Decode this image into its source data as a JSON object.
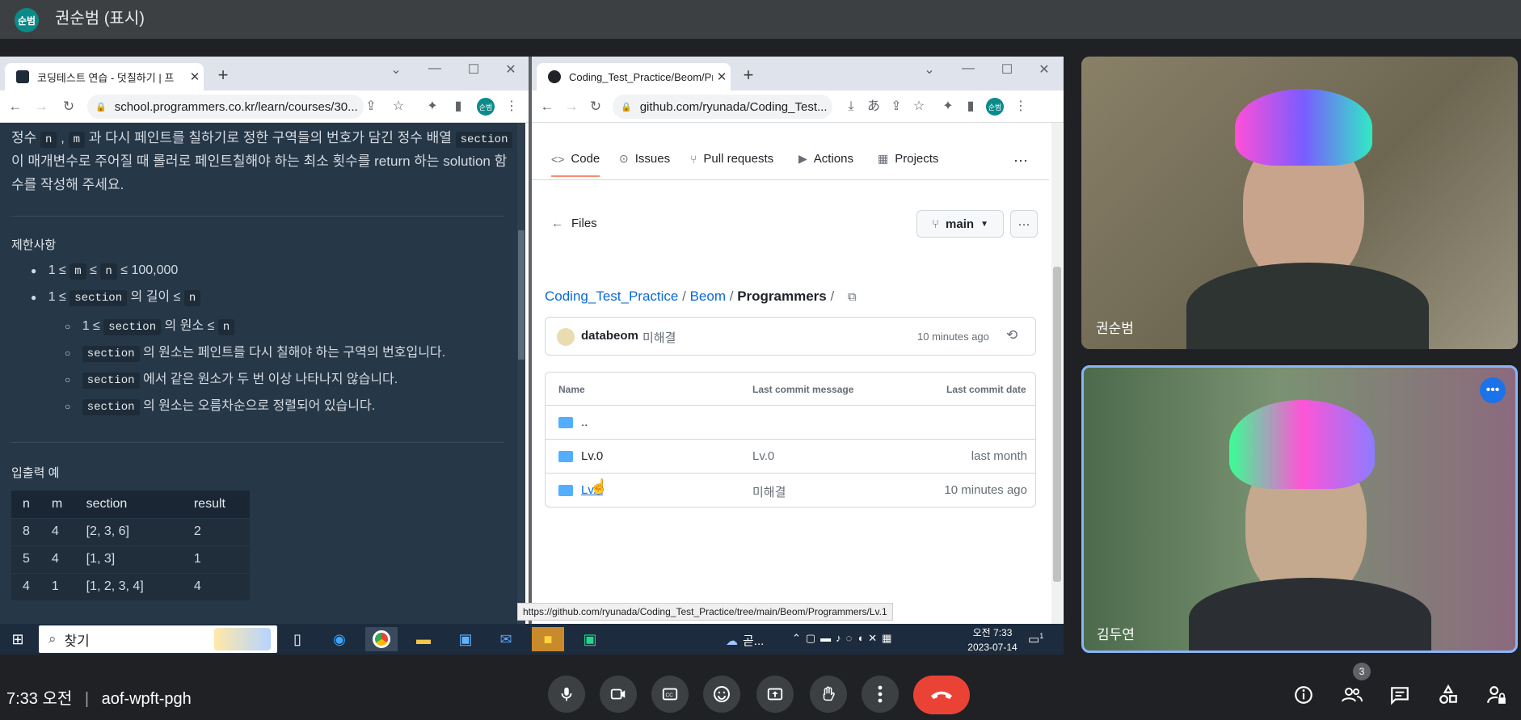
{
  "presenter": {
    "avatar": "순범",
    "title": "권순범 (표시)"
  },
  "left_browser": {
    "tab_title": "코딩테스트 연습 - 덧칠하기 | 프",
    "url": "school.programmers.co.kr/learn/courses/30...",
    "profile": "순범",
    "intro_line1_a": "정수",
    "intro_n": "n",
    "intro_sep": ",",
    "intro_m": "m",
    "intro_line1_b": "과 다시 페인트를 칠하기로 정한 구역들의 번호가 담긴 정수 배열",
    "intro_section": "section",
    "intro_line2": "이 매개변수로 주어질 때 롤러로 페인트칠해야 하는 최소 횟수를 return 하는 solution 함",
    "intro_line3": "수를 작성해 주세요.",
    "constraints_title": "제한사항",
    "c1_a": "1 ≤",
    "c1_m": "m",
    "c1_b": "≤",
    "c1_n": "n",
    "c1_c": "≤ 100,000",
    "c2_a": "1 ≤",
    "c2_code": "section",
    "c2_b": "의 길이 ≤",
    "c2_n": "n",
    "s1_a": "1 ≤",
    "s1_code": "section",
    "s1_b": "의 원소 ≤",
    "s1_n": "n",
    "s2_code": "section",
    "s2_text": "의 원소는 페인트를 다시 칠해야 하는 구역의 번호입니다.",
    "s3_code": "section",
    "s3_text": "에서 같은 원소가 두 번 이상 나타나지 않습니다.",
    "s4_code": "section",
    "s4_text": "의 원소는 오름차순으로 정렬되어 있습니다.",
    "examples_title": "입출력 예",
    "table_headers": [
      "n",
      "m",
      "section",
      "result"
    ],
    "table_rows": [
      [
        "8",
        "4",
        "[2, 3, 6]",
        "2"
      ],
      [
        "5",
        "4",
        "[1, 3]",
        "1"
      ],
      [
        "4",
        "1",
        "[1, 2, 3, 4]",
        "4"
      ]
    ]
  },
  "right_browser": {
    "tab_title": "Coding_Test_Practice/Beom/Pro",
    "url": "github.com/ryunada/Coding_Test...",
    "profile": "순범",
    "tabs": {
      "code": "Code",
      "issues": "Issues",
      "pulls": "Pull requests",
      "actions": "Actions",
      "projects": "Projects"
    },
    "files_label": "Files",
    "branch": "main",
    "crumb_repo": "Coding_Test_Practice",
    "crumb_sep1": "/",
    "crumb_dir": "Beom",
    "crumb_sep2": "/",
    "crumb_current": "Programmers",
    "crumb_sep3": "/",
    "commit_author": "databeom",
    "commit_message": "미해결",
    "commit_time": "10 minutes ago",
    "col_name": "Name",
    "col_msg": "Last commit message",
    "col_date": "Last commit date",
    "rows": [
      {
        "name": "..",
        "msg": "",
        "date": ""
      },
      {
        "name": "Lv.0",
        "msg": "Lv.0",
        "date": "last month"
      },
      {
        "name": "Lv.1",
        "msg": "미해결",
        "date": "10 minutes ago"
      }
    ],
    "status_url": "https://github.com/ryunada/Coding_Test_Practice/tree/main/Beom/Programmers/Lv.1"
  },
  "taskbar": {
    "search": "찾기",
    "weather": "곧...",
    "time": "오전 7:33",
    "date": "2023-07-14",
    "notif": "1"
  },
  "participants": [
    {
      "name": "권순범"
    },
    {
      "name": "김두연"
    }
  ],
  "meeting": {
    "time": "7:33 오전",
    "separator": "|",
    "code": "aof-wpft-pgh",
    "people_count": "3"
  },
  "colors": {
    "accent": "#1a73e8",
    "end_call": "#ea4335",
    "github_link": "#0969da",
    "programmers_bg": "#263747"
  }
}
